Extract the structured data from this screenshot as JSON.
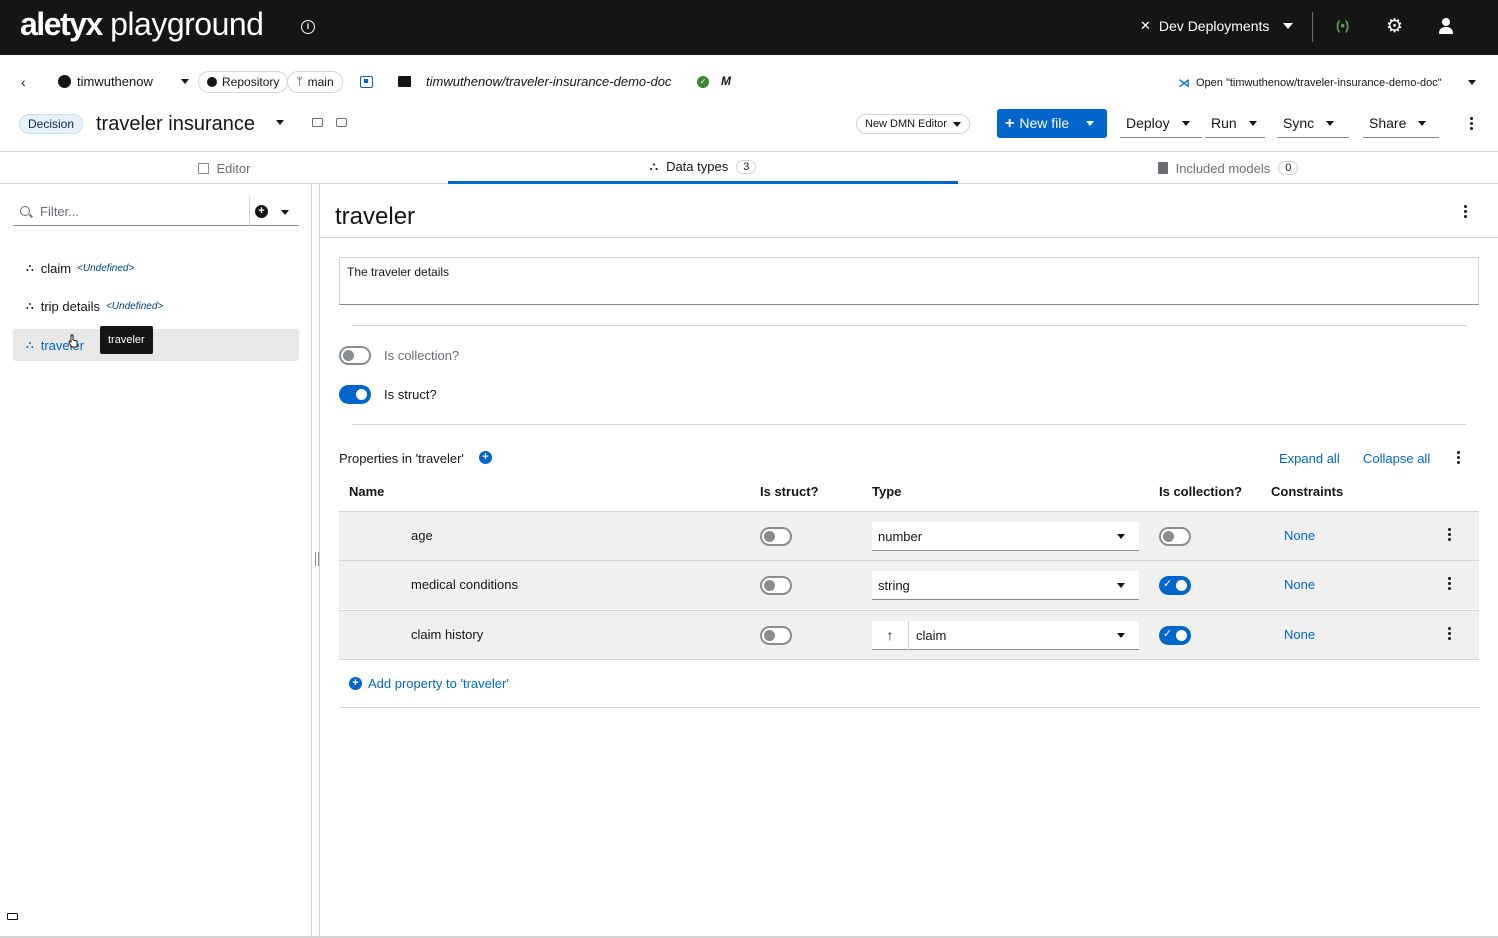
{
  "topbar": {
    "brand_bold": "aletyx",
    "brand_light": "playground",
    "deployments_label": "Dev Deployments"
  },
  "repobar": {
    "account": "timwuthenow",
    "repository_label": "Repository",
    "branch": "main",
    "path": "timwuthenow/traveler-insurance-demo-doc",
    "modified_flag": "M",
    "open_label": "Open \"timwuthenow/traveler-insurance-demo-doc\""
  },
  "titlebar": {
    "badge": "Decision",
    "model_name": "traveler insurance",
    "editor_selector": "New DMN Editor",
    "new_file": "New file",
    "deploy": "Deploy",
    "run": "Run",
    "sync": "Sync",
    "share": "Share"
  },
  "tabs": [
    {
      "label": "Editor",
      "count": null
    },
    {
      "label": "Data types",
      "count": "3"
    },
    {
      "label": "Included models",
      "count": "0"
    }
  ],
  "sidebar": {
    "filter_placeholder": "Filter...",
    "items": [
      {
        "label": "claim",
        "tag": "<Undefined>"
      },
      {
        "label": "trip details",
        "tag": "<Undefined>"
      },
      {
        "label": "traveler",
        "tag": ""
      }
    ],
    "tooltip": "traveler"
  },
  "detail": {
    "title": "traveler",
    "description": "The traveler details",
    "is_collection_label": "Is collection?",
    "is_collection": false,
    "is_struct_label": "Is struct?",
    "is_struct": true,
    "properties_title": "Properties in 'traveler'",
    "expand_all": "Expand all",
    "collapse_all": "Collapse all",
    "columns": {
      "name": "Name",
      "is_struct": "Is struct?",
      "type": "Type",
      "is_collection": "Is collection?",
      "constraints": "Constraints"
    },
    "properties": [
      {
        "name": "age",
        "is_struct": false,
        "type": "number",
        "is_collection": false,
        "constraints": "None"
      },
      {
        "name": "medical conditions",
        "is_struct": false,
        "type": "string",
        "is_collection": true,
        "constraints": "None"
      },
      {
        "name": "claim history",
        "is_struct": false,
        "type": "claim",
        "is_collection": true,
        "constraints": "None"
      }
    ],
    "add_property": "Add property to 'traveler'"
  }
}
